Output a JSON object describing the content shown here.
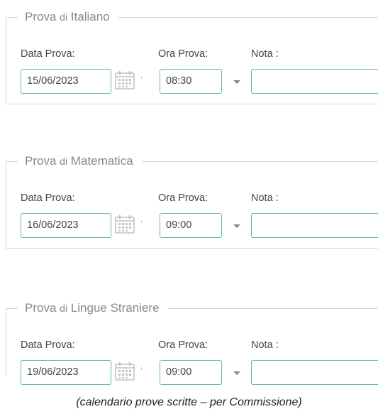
{
  "common": {
    "date_label": "Data Prova:",
    "time_label": "Ora Prova:",
    "note_label": "Nota :"
  },
  "sections": [
    {
      "legend_prefix": "Prova",
      "legend_mid": "di",
      "legend_suffix": "Italiano",
      "date": "15/06/2023",
      "time": "08:30",
      "note": ""
    },
    {
      "legend_prefix": "Prova",
      "legend_mid": "di",
      "legend_suffix": "Matematica",
      "date": "16/06/2023",
      "time": "09:00",
      "note": ""
    },
    {
      "legend_prefix": "Prova",
      "legend_mid": "di",
      "legend_suffix": "Lingue Straniere",
      "date": "19/06/2023",
      "time": "09:00",
      "note": ""
    }
  ],
  "caption": "(calendario prove scritte – per Commissione)",
  "colors": {
    "input_border": "#5fb7b1",
    "fieldset_border": "#d6d6d6",
    "legend_text": "#888888"
  },
  "icons": {
    "date_picker": "calendar-icon",
    "time_dropdown": "chevron-down-icon"
  }
}
